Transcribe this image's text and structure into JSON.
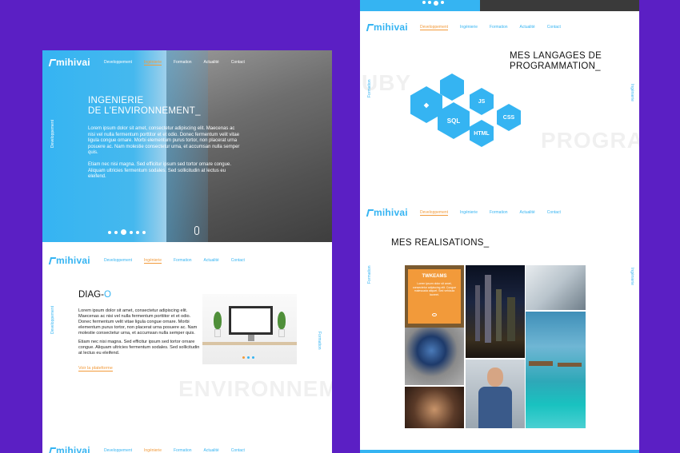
{
  "nav": {
    "logo": "mihivai",
    "links": [
      "Developpement",
      "Ingénierie",
      "Formation",
      "Actualité",
      "Contact"
    ]
  },
  "hero": {
    "title_line1": "INGENIERIE",
    "title_line2": "DE L'ENVIRONNEMENT_",
    "paragraph1": "Lorem ipsum dolor sit amet, consectetur adipiscing elit. Maecenas ac nisi vel nulla fermentum porttitor et et odio. Donec fermentum velit vitae ligula congue ornare. Morbi elementum purus tortor, non placerat urna posuere ac. Nam molestie consectetur urna, et accumsan nulla semper quis.",
    "paragraph2": "Etiam nec nisi magna. Sed efficitur ipsum sed tortor ornare congue. Aliquam ultricies fermentum sodales. Sed sollicitudin at lectus eu eleifend.",
    "side_label": "Developpement"
  },
  "diag": {
    "title_main": "DIAG-",
    "title_accent": "O",
    "paragraph1": "Lorem ipsum dolor sit amet, consectetur adipiscing elit. Maecenas ac nisi vel nulla fermentum porttitor et et odio. Donec fermentum velit vitae ligula congue ornare. Morbi elementum purus tortor, non placerat urna posuere ac. Nam molestie consectetur urna, et accumsan nulla semper quis.",
    "paragraph2": "Etiam nec nisi magna. Sed efficitur ipsum sed tortor ornare congue. Aliquam ultricies fermentum sodales. Sed sollicitudin at lectus eu eleifend.",
    "link": "Voir la plateforme",
    "side_left": "Developpement",
    "side_right": "Formation",
    "ghost_text": "ENVIRONNEMENT"
  },
  "langages": {
    "title_line1": "MES LANGAGES DE",
    "title_line2": "PROGRAMMATION_",
    "ghost_left": "UBY",
    "ghost_right": "PROGRA",
    "side_left": "Formation",
    "side_right": "Ingénierie",
    "hex_labels": [
      "",
      "",
      "JS",
      "CSS",
      "SQL",
      "HTML"
    ]
  },
  "realisations": {
    "title": "MES REALISATIONS_",
    "side_left": "Formation",
    "side_right": "Ingénierie",
    "card_title": "TWKEAMS",
    "card_text": "Lorem ipsum dolor sit amet, consectetur adipiscing elit. Congue malesuada aliquet. Sed vehicula laoreet."
  },
  "colors": {
    "accent": "#35b4f2",
    "orange": "#f29a3a",
    "background": "#5b1fc4"
  }
}
